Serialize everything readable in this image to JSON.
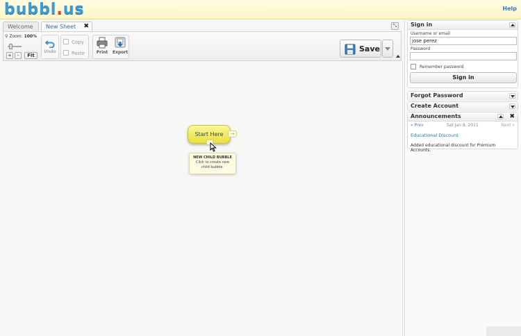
{
  "header": {
    "logo_main": "bubbl",
    "logo_dot": ".",
    "logo_tld": "us",
    "help_label": "Help"
  },
  "tabs": [
    {
      "label": "Welcome",
      "active": false
    },
    {
      "label": "New Sheet",
      "active": true,
      "close_icon": "✖"
    }
  ],
  "toolbar": {
    "zoom_label": "Zoom:",
    "zoom_value": "100%",
    "zoom_plus": "+",
    "zoom_minus": "-",
    "zoom_fit": "Fit",
    "undo_label": "Undo",
    "copy_label": "Copy",
    "paste_label": "Paste",
    "print_label": "Print",
    "export_label": "Export",
    "save_label": "Save"
  },
  "canvas": {
    "bubble_text": "Start Here",
    "tooltip_title": "NEW CHILD BUBBLE",
    "tooltip_line1": "Click to create new",
    "tooltip_line2": "child bubble."
  },
  "signin": {
    "title": "Sign in",
    "username_label": "Username or email",
    "username_value": "jose perez",
    "password_label": "Password",
    "password_value": "",
    "remember_label": "Remember password",
    "button_label": "Sign in"
  },
  "forgot": {
    "title": "Forgot Password"
  },
  "create": {
    "title": "Create Account"
  },
  "announcements": {
    "title": "Announcements",
    "prev": "« Prev",
    "date": "Sat Jan 8, 2011",
    "next": "Next »",
    "item_title": "Educational Discount",
    "item_text": "Added educational discount for Premium Accounts."
  },
  "colors": {
    "logo_blue": "#3a9bd6",
    "logo_red": "#e04a3a",
    "bubble_yellow": "#eee95a",
    "link_blue": "#2a6fa8"
  }
}
